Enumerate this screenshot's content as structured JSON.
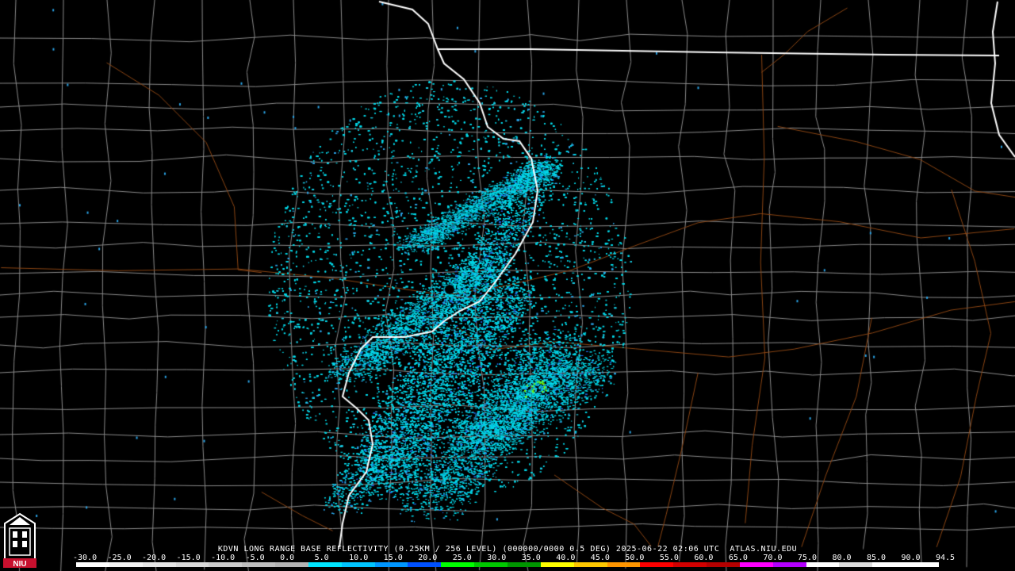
{
  "header": {
    "title": "KDVN LONG RANGE BASE REFLECTIVITY (0.25KM / 256 LEVEL) (000000/0000 0.5 DEG) 2025-06-22 02:06 UTC  ATLAS.NIU.EDU"
  },
  "colorbar": {
    "ticks": [
      "-30.0",
      "-25.0",
      "-20.0",
      "-15.0",
      "-10.0",
      "-5.0",
      "0.0",
      "5.0",
      "10.0",
      "15.0",
      "20.0",
      "25.0",
      "30.0",
      "35.0",
      "40.0",
      "45.0",
      "50.0",
      "55.0",
      "60.0",
      "65.0",
      "70.0",
      "75.0",
      "80.0",
      "85.0",
      "90.0",
      "94.5"
    ],
    "colors": [
      "#ffffff",
      "#f2f2f2",
      "#e6e6e6",
      "#d9d9d9",
      "#cccccc",
      "#bfbfbf",
      "#b3b3b3",
      "#00e5ff",
      "#00c4ff",
      "#0096ff",
      "#0050ff",
      "#00ff00",
      "#00c800",
      "#009600",
      "#ffff00",
      "#ffc800",
      "#ff9600",
      "#ff0000",
      "#d20000",
      "#b40000",
      "#ff00ff",
      "#b400ff",
      "#ffffff",
      "#dddddd",
      "#ffffff",
      "#ffffff"
    ]
  },
  "logo": {
    "text": "NIU"
  },
  "map": {
    "background": "#000000",
    "county_line_color": "#8a8a8a",
    "state_line_color": "#ffffff",
    "road_color": "#8b4513",
    "echo_colors": [
      "#00d8e8",
      "#19c8e0",
      "#2aa3e6",
      "#1f6cf0"
    ],
    "radar_site": "KDVN"
  }
}
